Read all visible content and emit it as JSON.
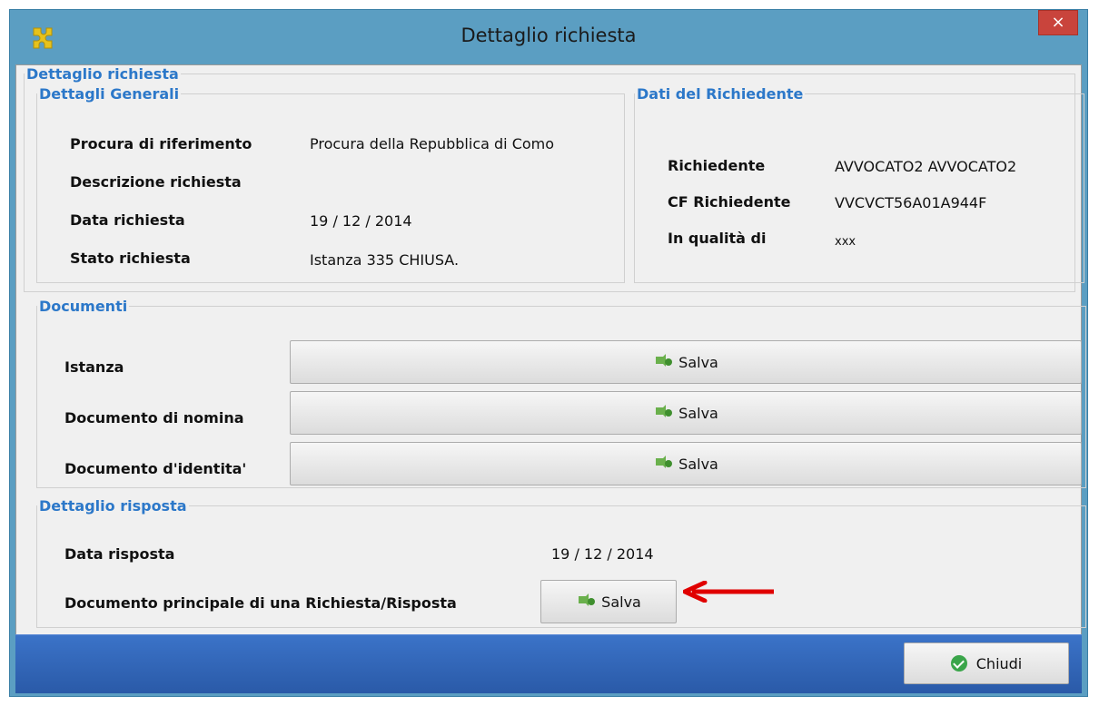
{
  "window": {
    "title": "Dettaglio richiesta",
    "close_label": "×"
  },
  "main_group": {
    "legend": "Dettaglio richiesta"
  },
  "general": {
    "legend": "Dettagli Generali",
    "rows": [
      {
        "label": "Procura di riferimento",
        "value": "Procura della Repubblica di Como"
      },
      {
        "label": "Descrizione richiesta",
        "value": ""
      },
      {
        "label": "Data richiesta",
        "value": "19 / 12 / 2014"
      },
      {
        "label": "Stato richiesta",
        "value": "Istanza 335 CHIUSA."
      }
    ]
  },
  "applicant": {
    "legend": "Dati del Richiedente",
    "rows": [
      {
        "label": "Richiedente",
        "value": "AVVOCATO2 AVVOCATO2"
      },
      {
        "label": "CF Richiedente",
        "value": "VVCVCT56A01A944F"
      },
      {
        "label": "In qualità di",
        "value": "xxx"
      }
    ]
  },
  "documents": {
    "legend": "Documenti",
    "rows": [
      {
        "label": "Istanza",
        "button": "Salva"
      },
      {
        "label": "Documento di nomina",
        "button": "Salva"
      },
      {
        "label": "Documento d'identita'",
        "button": "Salva"
      }
    ]
  },
  "response": {
    "legend": "Dettaglio risposta",
    "date_label": "Data risposta",
    "date_value": "19 / 12 / 2014",
    "doc_label": "Documento principale di una Richiesta/Risposta",
    "doc_button": "Salva"
  },
  "footer": {
    "close_button": "Chiudi"
  },
  "colors": {
    "legend": "#2c78c9",
    "titlebar": "#5b9ec2",
    "footer": "#2f63b5",
    "close": "#c9443c",
    "arrow": "#e00000"
  }
}
